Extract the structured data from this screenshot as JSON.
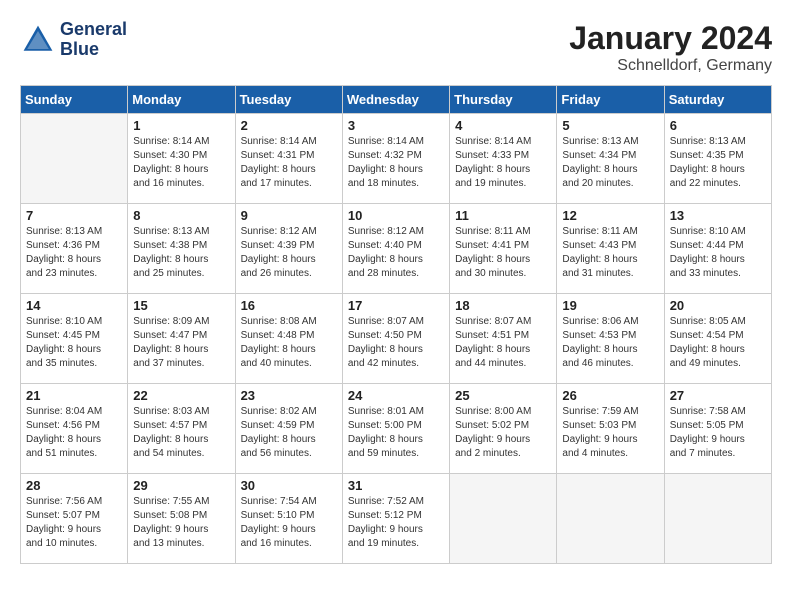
{
  "header": {
    "logo_line1": "General",
    "logo_line2": "Blue",
    "month_year": "January 2024",
    "location": "Schnelldorf, Germany"
  },
  "weekdays": [
    "Sunday",
    "Monday",
    "Tuesday",
    "Wednesday",
    "Thursday",
    "Friday",
    "Saturday"
  ],
  "weeks": [
    [
      {
        "day": "",
        "info": ""
      },
      {
        "day": "1",
        "info": "Sunrise: 8:14 AM\nSunset: 4:30 PM\nDaylight: 8 hours\nand 16 minutes."
      },
      {
        "day": "2",
        "info": "Sunrise: 8:14 AM\nSunset: 4:31 PM\nDaylight: 8 hours\nand 17 minutes."
      },
      {
        "day": "3",
        "info": "Sunrise: 8:14 AM\nSunset: 4:32 PM\nDaylight: 8 hours\nand 18 minutes."
      },
      {
        "day": "4",
        "info": "Sunrise: 8:14 AM\nSunset: 4:33 PM\nDaylight: 8 hours\nand 19 minutes."
      },
      {
        "day": "5",
        "info": "Sunrise: 8:13 AM\nSunset: 4:34 PM\nDaylight: 8 hours\nand 20 minutes."
      },
      {
        "day": "6",
        "info": "Sunrise: 8:13 AM\nSunset: 4:35 PM\nDaylight: 8 hours\nand 22 minutes."
      }
    ],
    [
      {
        "day": "7",
        "info": "Sunrise: 8:13 AM\nSunset: 4:36 PM\nDaylight: 8 hours\nand 23 minutes."
      },
      {
        "day": "8",
        "info": "Sunrise: 8:13 AM\nSunset: 4:38 PM\nDaylight: 8 hours\nand 25 minutes."
      },
      {
        "day": "9",
        "info": "Sunrise: 8:12 AM\nSunset: 4:39 PM\nDaylight: 8 hours\nand 26 minutes."
      },
      {
        "day": "10",
        "info": "Sunrise: 8:12 AM\nSunset: 4:40 PM\nDaylight: 8 hours\nand 28 minutes."
      },
      {
        "day": "11",
        "info": "Sunrise: 8:11 AM\nSunset: 4:41 PM\nDaylight: 8 hours\nand 30 minutes."
      },
      {
        "day": "12",
        "info": "Sunrise: 8:11 AM\nSunset: 4:43 PM\nDaylight: 8 hours\nand 31 minutes."
      },
      {
        "day": "13",
        "info": "Sunrise: 8:10 AM\nSunset: 4:44 PM\nDaylight: 8 hours\nand 33 minutes."
      }
    ],
    [
      {
        "day": "14",
        "info": "Sunrise: 8:10 AM\nSunset: 4:45 PM\nDaylight: 8 hours\nand 35 minutes."
      },
      {
        "day": "15",
        "info": "Sunrise: 8:09 AM\nSunset: 4:47 PM\nDaylight: 8 hours\nand 37 minutes."
      },
      {
        "day": "16",
        "info": "Sunrise: 8:08 AM\nSunset: 4:48 PM\nDaylight: 8 hours\nand 40 minutes."
      },
      {
        "day": "17",
        "info": "Sunrise: 8:07 AM\nSunset: 4:50 PM\nDaylight: 8 hours\nand 42 minutes."
      },
      {
        "day": "18",
        "info": "Sunrise: 8:07 AM\nSunset: 4:51 PM\nDaylight: 8 hours\nand 44 minutes."
      },
      {
        "day": "19",
        "info": "Sunrise: 8:06 AM\nSunset: 4:53 PM\nDaylight: 8 hours\nand 46 minutes."
      },
      {
        "day": "20",
        "info": "Sunrise: 8:05 AM\nSunset: 4:54 PM\nDaylight: 8 hours\nand 49 minutes."
      }
    ],
    [
      {
        "day": "21",
        "info": "Sunrise: 8:04 AM\nSunset: 4:56 PM\nDaylight: 8 hours\nand 51 minutes."
      },
      {
        "day": "22",
        "info": "Sunrise: 8:03 AM\nSunset: 4:57 PM\nDaylight: 8 hours\nand 54 minutes."
      },
      {
        "day": "23",
        "info": "Sunrise: 8:02 AM\nSunset: 4:59 PM\nDaylight: 8 hours\nand 56 minutes."
      },
      {
        "day": "24",
        "info": "Sunrise: 8:01 AM\nSunset: 5:00 PM\nDaylight: 8 hours\nand 59 minutes."
      },
      {
        "day": "25",
        "info": "Sunrise: 8:00 AM\nSunset: 5:02 PM\nDaylight: 9 hours\nand 2 minutes."
      },
      {
        "day": "26",
        "info": "Sunrise: 7:59 AM\nSunset: 5:03 PM\nDaylight: 9 hours\nand 4 minutes."
      },
      {
        "day": "27",
        "info": "Sunrise: 7:58 AM\nSunset: 5:05 PM\nDaylight: 9 hours\nand 7 minutes."
      }
    ],
    [
      {
        "day": "28",
        "info": "Sunrise: 7:56 AM\nSunset: 5:07 PM\nDaylight: 9 hours\nand 10 minutes."
      },
      {
        "day": "29",
        "info": "Sunrise: 7:55 AM\nSunset: 5:08 PM\nDaylight: 9 hours\nand 13 minutes."
      },
      {
        "day": "30",
        "info": "Sunrise: 7:54 AM\nSunset: 5:10 PM\nDaylight: 9 hours\nand 16 minutes."
      },
      {
        "day": "31",
        "info": "Sunrise: 7:52 AM\nSunset: 5:12 PM\nDaylight: 9 hours\nand 19 minutes."
      },
      {
        "day": "",
        "info": ""
      },
      {
        "day": "",
        "info": ""
      },
      {
        "day": "",
        "info": ""
      }
    ]
  ]
}
